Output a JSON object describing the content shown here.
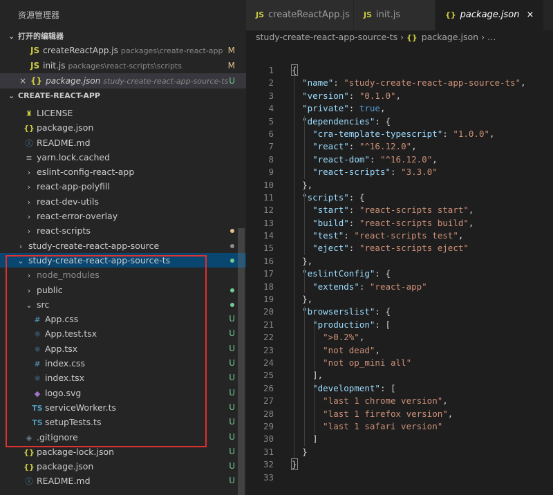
{
  "sidebar": {
    "title": "资源管理器",
    "open_editors": {
      "label": "打开的编辑器",
      "items": [
        {
          "name": "createReactApp.js",
          "path": "packages\\create-react-app",
          "status": "M",
          "icon": "js-file-icon"
        },
        {
          "name": "init.js",
          "path": "packages\\react-scripts\\scripts",
          "status": "M",
          "icon": "js-file-icon"
        },
        {
          "name": "package.json",
          "path": "study-create-react-app-source-ts",
          "status": "U",
          "icon": "json-file-icon"
        }
      ]
    },
    "project_label": "CREATE-REACT-APP",
    "tree": [
      {
        "label": "LICENSE",
        "icon": "license-icon",
        "depth": 1
      },
      {
        "label": "package.json",
        "icon": "json-file-icon",
        "depth": 1
      },
      {
        "label": "README.md",
        "icon": "info-icon",
        "depth": 1
      },
      {
        "label": "yarn.lock.cached",
        "icon": "file-icon",
        "depth": 1
      },
      {
        "label": "eslint-config-react-app",
        "icon": "chevron-right-icon",
        "depth": 1
      },
      {
        "label": "react-app-polyfill",
        "icon": "chevron-right-icon",
        "depth": 1
      },
      {
        "label": "react-dev-utils",
        "icon": "chevron-right-icon",
        "depth": 1
      },
      {
        "label": "react-error-overlay",
        "icon": "chevron-right-icon",
        "depth": 1
      },
      {
        "label": "react-scripts",
        "icon": "chevron-right-icon",
        "depth": 1
      },
      {
        "label": "study-create-react-app-source",
        "icon": "chevron-right-icon",
        "depth": 0
      },
      {
        "label": "study-create-react-app-source-ts",
        "icon": "chevron-down-icon",
        "depth": 0
      },
      {
        "label": "node_modules",
        "icon": "chevron-right-icon",
        "depth": 1
      },
      {
        "label": "public",
        "icon": "chevron-right-icon",
        "depth": 1
      },
      {
        "label": "src",
        "icon": "chevron-down-icon",
        "depth": 1
      },
      {
        "label": "App.css",
        "icon": "hash-icon",
        "depth": 2,
        "status": "U"
      },
      {
        "label": "App.test.tsx",
        "icon": "react-icon",
        "depth": 2,
        "status": "U"
      },
      {
        "label": "App.tsx",
        "icon": "react-icon",
        "depth": 2,
        "status": "U"
      },
      {
        "label": "index.css",
        "icon": "hash-icon",
        "depth": 2,
        "status": "U"
      },
      {
        "label": "index.tsx",
        "icon": "react-icon",
        "depth": 2,
        "status": "U"
      },
      {
        "label": "logo.svg",
        "icon": "svg-icon",
        "depth": 2,
        "status": "U"
      },
      {
        "label": "serviceWorker.ts",
        "icon": "ts-icon",
        "depth": 2,
        "status": "U"
      },
      {
        "label": "setupTests.ts",
        "icon": "ts-icon",
        "depth": 2,
        "status": "U"
      },
      {
        "label": ".gitignore",
        "icon": "diamond-icon",
        "depth": 1,
        "status": "U"
      },
      {
        "label": "package-lock.json",
        "icon": "json-file-icon",
        "depth": 1,
        "status": "U"
      },
      {
        "label": "package.json",
        "icon": "json-file-icon",
        "depth": 1,
        "status": "U"
      },
      {
        "label": "README.md",
        "icon": "info-icon",
        "depth": 1,
        "status": "U"
      }
    ],
    "icon_glyphs": {
      "js": "JS",
      "json": "{}",
      "ts": "TS",
      "hash": "#",
      "close": "×"
    }
  },
  "editor": {
    "tabs": [
      {
        "label": "createReactApp.js",
        "icon": "js-file-icon",
        "active": false
      },
      {
        "label": "init.js",
        "icon": "js-file-icon",
        "active": false
      },
      {
        "label": "package.json",
        "icon": "json-file-icon",
        "active": true
      }
    ],
    "breadcrumb": {
      "folder": "study-create-react-app-source-ts",
      "file": "package.json",
      "more": "…"
    },
    "lines": [
      "{",
      "  \"name\": \"study-create-react-app-source-ts\",",
      "  \"version\": \"0.1.0\",",
      "  \"private\": true,",
      "  \"dependencies\": {",
      "    \"cra-template-typescript\": \"1.0.0\",",
      "    \"react\": \"^16.12.0\",",
      "    \"react-dom\": \"^16.12.0\",",
      "    \"react-scripts\": \"3.3.0\"",
      "  },",
      "  \"scripts\": {",
      "    \"start\": \"react-scripts start\",",
      "    \"build\": \"react-scripts build\",",
      "    \"test\": \"react-scripts test\",",
      "    \"eject\": \"react-scripts eject\"",
      "  },",
      "  \"eslintConfig\": {",
      "    \"extends\": \"react-app\"",
      "  },",
      "  \"browserslist\": {",
      "    \"production\": [",
      "      \">0.2%\",",
      "      \"not dead\",",
      "      \"not op_mini all\"",
      "    ],",
      "    \"development\": [",
      "      \"last 1 chrome version\",",
      "      \"last 1 firefox version\",",
      "      \"last 1 safari version\"",
      "    ]",
      "  }",
      "}",
      ""
    ]
  },
  "colors": {
    "modified": "#e2c08d",
    "untracked": "#73c991",
    "selection": "#094771",
    "highlight_box": "#e03030"
  }
}
